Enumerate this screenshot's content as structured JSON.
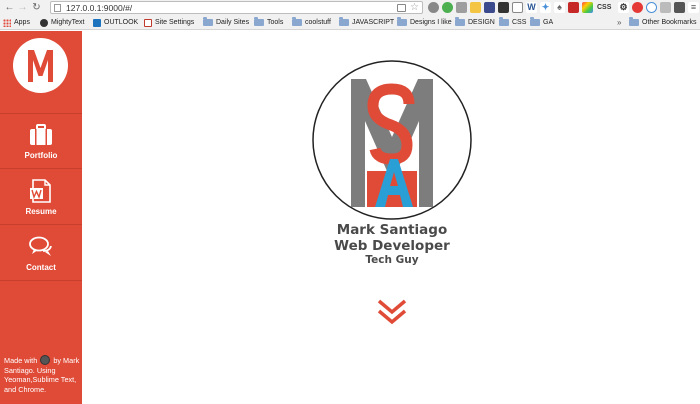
{
  "browser": {
    "url": "127.0.0.1:9000/#/",
    "ext_label": "CSS",
    "bookmarks": [
      {
        "label": "Apps",
        "icon": "apps-grid-icon"
      },
      {
        "label": "MightyText",
        "icon": "mightytext-icon"
      },
      {
        "label": "OUTLOOK",
        "icon": "outlook-icon"
      },
      {
        "label": "Site Settings",
        "icon": "site-settings-icon"
      },
      {
        "label": "Daily Sites",
        "icon": "folder-icon"
      },
      {
        "label": "Tools",
        "icon": "folder-icon"
      },
      {
        "label": "coolstuff",
        "icon": "folder-icon"
      },
      {
        "label": "JAVASCRIPT",
        "icon": "folder-icon"
      },
      {
        "label": "Designs I like",
        "icon": "folder-icon"
      },
      {
        "label": "DESIGN",
        "icon": "folder-icon"
      },
      {
        "label": "CSS",
        "icon": "folder-icon"
      },
      {
        "label": "GA",
        "icon": "folder-icon"
      }
    ],
    "more_chevron": "»",
    "other_bookmarks": "Other Bookmarks"
  },
  "sidebar": {
    "logo_letter": "M",
    "items": [
      {
        "label": "Portfolio",
        "icon": "briefcase-icon"
      },
      {
        "label": "Resume",
        "icon": "word-document-icon"
      },
      {
        "label": "Contact",
        "icon": "chat-bubbles-icon"
      }
    ],
    "footer_before": "Made with",
    "footer_after": "by Mark Santiago. Using Yeoman,Sublime Text, and Chrome."
  },
  "hero": {
    "name": "Mark Santiago",
    "role": "Web Developer",
    "tagline": "Tech Guy"
  },
  "colors": {
    "accent": "#e04b38",
    "blue": "#2a9fd6",
    "gray": "#7d7d7d",
    "text": "#4a4a4a"
  }
}
